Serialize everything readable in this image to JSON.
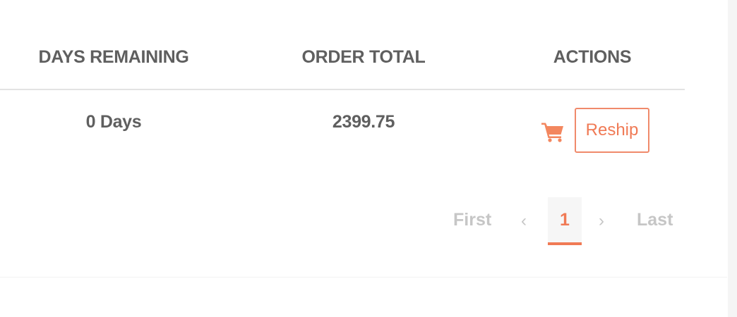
{
  "table": {
    "headers": {
      "days_remaining": "DAYS REMAINING",
      "order_total": "ORDER TOTAL",
      "actions": "ACTIONS"
    },
    "rows": [
      {
        "days_remaining": "0 Days",
        "order_total": "2399.75",
        "cart_icon": "shopping-cart-icon",
        "reship_label": "Reship"
      }
    ]
  },
  "pagination": {
    "first": "First",
    "prev": "‹",
    "current": "1",
    "next": "›",
    "last": "Last"
  },
  "colors": {
    "accent": "#f07a55",
    "text": "#5f5f5f",
    "muted": "#c6c6c6"
  }
}
